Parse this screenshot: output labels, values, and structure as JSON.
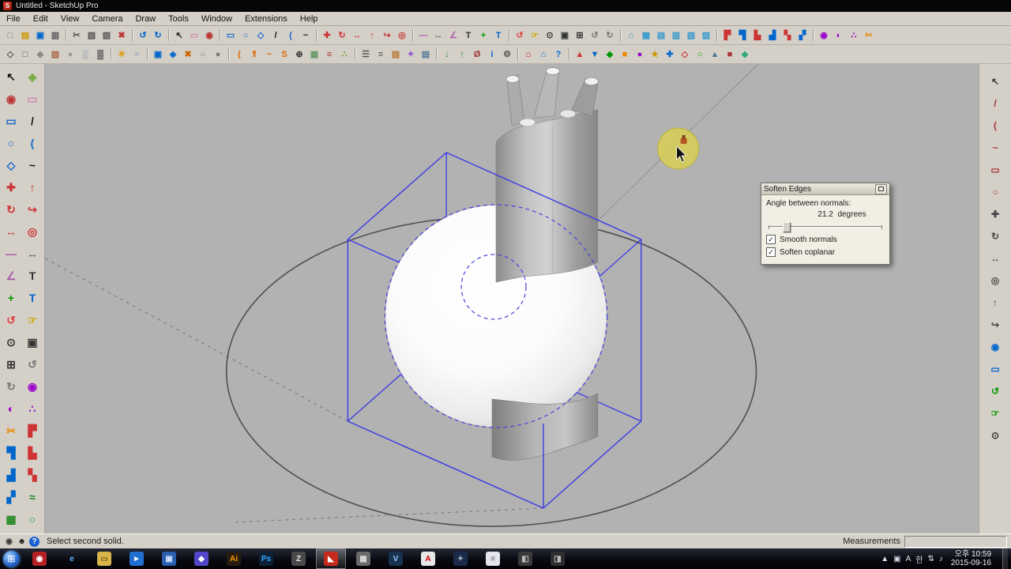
{
  "window": {
    "title": "Untitled - SketchUp Pro",
    "app_icon": "S"
  },
  "menu": {
    "items": [
      "File",
      "Edit",
      "View",
      "Camera",
      "Draw",
      "Tools",
      "Window",
      "Extensions",
      "Help"
    ]
  },
  "toolbar_row1": [
    [
      "new",
      "□",
      "#777"
    ],
    [
      "open",
      "▤",
      "#c90"
    ],
    [
      "save",
      "▣",
      "#06c"
    ],
    [
      "print",
      "▥",
      "#555"
    ],
    [
      "sep"
    ],
    [
      "cut",
      "✂",
      "#555"
    ],
    [
      "copy",
      "▧",
      "#555"
    ],
    [
      "paste",
      "▨",
      "#555"
    ],
    [
      "erase-selected",
      "✖",
      "#b33"
    ],
    [
      "sep"
    ],
    [
      "undo",
      "↺",
      "#06c"
    ],
    [
      "redo",
      "↻",
      "#06c"
    ],
    [
      "sep"
    ],
    [
      "select",
      "↖",
      "#111"
    ],
    [
      "eraser",
      "▭",
      "#c8a"
    ],
    [
      "paint-bucket",
      "◉",
      "#b33"
    ],
    [
      "sep"
    ],
    [
      "rectangle",
      "▭",
      "#16c"
    ],
    [
      "circle",
      "○",
      "#16c"
    ],
    [
      "polygon",
      "◇",
      "#16c"
    ],
    [
      "line",
      "/",
      "#111"
    ],
    [
      "arc",
      "(",
      "#16c"
    ],
    [
      "freehand",
      "~",
      "#111"
    ],
    [
      "sep"
    ],
    [
      "move",
      "✚",
      "#c33"
    ],
    [
      "rotate",
      "↻",
      "#c33"
    ],
    [
      "scale",
      "↔",
      "#c33"
    ],
    [
      "push-pull",
      "↑",
      "#c33"
    ],
    [
      "follow-me",
      "↪",
      "#c33"
    ],
    [
      "offset",
      "◎",
      "#c33"
    ],
    [
      "sep"
    ],
    [
      "tape-measure",
      "―",
      "#a5a"
    ],
    [
      "dimension",
      "↔",
      "#555"
    ],
    [
      "protractor",
      "∠",
      "#a5a"
    ],
    [
      "text",
      "T",
      "#333"
    ],
    [
      "axes",
      "+",
      "#090"
    ],
    [
      "3d-text",
      "T",
      "#06c"
    ],
    [
      "sep"
    ],
    [
      "orbit",
      "↺",
      "#d44"
    ],
    [
      "pan",
      "☞",
      "#ca0"
    ],
    [
      "zoom",
      "⊙",
      "#333"
    ],
    [
      "zoom-window",
      "▣",
      "#333"
    ],
    [
      "zoom-extents",
      "⊞",
      "#333"
    ],
    [
      "zoom-previous",
      "↺",
      "#777"
    ],
    [
      "zoom-next",
      "↻",
      "#777"
    ],
    [
      "sep"
    ],
    [
      "views-iso",
      "⌂",
      "#39c"
    ],
    [
      "views-top",
      "▦",
      "#39c"
    ],
    [
      "views-front",
      "▤",
      "#39c"
    ],
    [
      "views-right",
      "▥",
      "#39c"
    ],
    [
      "views-back",
      "▧",
      "#39c"
    ],
    [
      "views-left",
      "▨",
      "#39c"
    ],
    [
      "sep"
    ],
    [
      "solid-outer-shell",
      "▛",
      "#c33"
    ],
    [
      "solid-intersect",
      "▜",
      "#06c"
    ],
    [
      "solid-union",
      "▙",
      "#c33"
    ],
    [
      "solid-subtract",
      "▟",
      "#06c"
    ],
    [
      "solid-trim",
      "▚",
      "#c33"
    ],
    [
      "solid-split",
      "▞",
      "#06c"
    ],
    [
      "sep"
    ],
    [
      "position-camera",
      "◉",
      "#90c"
    ],
    [
      "look-around",
      "◐",
      "#90c"
    ],
    [
      "walk",
      "∴",
      "#90c"
    ],
    [
      "section-plane",
      "✂",
      "#e80"
    ]
  ],
  "toolbar_row2": [
    [
      "wireframe",
      "◇",
      "#555"
    ],
    [
      "hidden-line",
      "□",
      "#555"
    ],
    [
      "shaded",
      "◆",
      "#888"
    ],
    [
      "shaded-textures",
      "▨",
      "#a64"
    ],
    [
      "monochrome",
      "●",
      "#999"
    ],
    [
      "x-ray",
      "▒",
      "#89a"
    ],
    [
      "back-edges",
      "▓",
      "#666"
    ],
    [
      "sep"
    ],
    [
      "shadows",
      "☀",
      "#d90"
    ],
    [
      "fog",
      "≈",
      "#9ab"
    ],
    [
      "sep"
    ],
    [
      "make-group",
      "▣",
      "#06c"
    ],
    [
      "make-component",
      "◈",
      "#06c"
    ],
    [
      "explode",
      "✖",
      "#c60"
    ],
    [
      "hide",
      "○",
      "#777"
    ],
    [
      "unhide",
      "●",
      "#777"
    ],
    [
      "sep"
    ],
    [
      "round-corner",
      "(",
      "#d60"
    ],
    [
      "joint-push-pull",
      "⇑",
      "#d60"
    ],
    [
      "curviloft",
      "~",
      "#d60"
    ],
    [
      "bezier-spline",
      "S",
      "#d60"
    ],
    [
      "weld",
      "⊕",
      "#333"
    ],
    [
      "soap-skin",
      "▦",
      "#696"
    ],
    [
      "slicer",
      "≡",
      "#a33"
    ],
    [
      "component-spray",
      "∴",
      "#693"
    ],
    [
      "sep"
    ],
    [
      "layers-panel",
      "☰",
      "#555"
    ],
    [
      "outliner",
      "≡",
      "#555"
    ],
    [
      "materials",
      "▧",
      "#b73"
    ],
    [
      "styles-panel",
      "✦",
      "#95c"
    ],
    [
      "scenes",
      "▤",
      "#579"
    ],
    [
      "sep"
    ],
    [
      "import",
      "↓",
      "#283"
    ],
    [
      "export",
      "↑",
      "#283"
    ],
    [
      "purge",
      "Ø",
      "#933"
    ],
    [
      "model-info",
      "i",
      "#06c"
    ],
    [
      "preferences",
      "⚙",
      "#555"
    ],
    [
      "sep"
    ],
    [
      "extension-warehouse",
      "⌂",
      "#b00"
    ],
    [
      "3d-warehouse",
      "⌂",
      "#06c"
    ],
    [
      "instructor",
      "?",
      "#06c"
    ],
    [
      "sep"
    ],
    [
      "plugin-a",
      "▲",
      "#c33"
    ],
    [
      "plugin-b",
      "▼",
      "#06c"
    ],
    [
      "plugin-c",
      "◆",
      "#090"
    ],
    [
      "plugin-d",
      "■",
      "#e80"
    ],
    [
      "plugin-e",
      "●",
      "#90c"
    ],
    [
      "plugin-f",
      "★",
      "#c90"
    ],
    [
      "plugin-g",
      "✚",
      "#06c"
    ],
    [
      "plugin-h",
      "◇",
      "#c33"
    ],
    [
      "plugin-i",
      "○",
      "#090"
    ],
    [
      "plugin-j",
      "▲",
      "#579"
    ],
    [
      "plugin-k",
      "■",
      "#a33"
    ],
    [
      "plugin-l",
      "◆",
      "#3a7"
    ]
  ],
  "left_palette": [
    [
      "select",
      "↖",
      "#111"
    ],
    [
      "make-component",
      "◈",
      "#7a4"
    ],
    [
      "paint-bucket",
      "◉",
      "#b33"
    ],
    [
      "eraser",
      "▭",
      "#c8a"
    ],
    [
      "rectangle",
      "▭",
      "#16c"
    ],
    [
      "line",
      "/",
      "#111"
    ],
    [
      "circle",
      "○",
      "#16c"
    ],
    [
      "arc",
      "(",
      "#16c"
    ],
    [
      "polygon",
      "◇",
      "#16c"
    ],
    [
      "freehand",
      "~",
      "#111"
    ],
    [
      "move",
      "✚",
      "#c33"
    ],
    [
      "push-pull",
      "↑",
      "#c33"
    ],
    [
      "rotate",
      "↻",
      "#c33"
    ],
    [
      "follow-me",
      "↪",
      "#c33"
    ],
    [
      "scale",
      "↔",
      "#c33"
    ],
    [
      "offset",
      "◎",
      "#c33"
    ],
    [
      "tape-measure",
      "―",
      "#a5a"
    ],
    [
      "dimension",
      "↔",
      "#555"
    ],
    [
      "protractor",
      "∠",
      "#a5a"
    ],
    [
      "text",
      "T",
      "#333"
    ],
    [
      "axes",
      "+",
      "#090"
    ],
    [
      "3d-text",
      "T",
      "#06c"
    ],
    [
      "orbit",
      "↺",
      "#d44"
    ],
    [
      "pan",
      "☞",
      "#ca0"
    ],
    [
      "zoom",
      "⊙",
      "#333"
    ],
    [
      "zoom-window",
      "▣",
      "#333"
    ],
    [
      "zoom-extents",
      "⊞",
      "#333"
    ],
    [
      "zoom-previous",
      "↺",
      "#777"
    ],
    [
      "zoom-next",
      "↻",
      "#777"
    ],
    [
      "position-camera",
      "◉",
      "#90c"
    ],
    [
      "look-around",
      "◐",
      "#90c"
    ],
    [
      "walk",
      "∴",
      "#90c"
    ],
    [
      "section-plane",
      "✂",
      "#e80"
    ],
    [
      "solid-outer-shell",
      "▛",
      "#c33"
    ],
    [
      "solid-intersect",
      "▜",
      "#06c"
    ],
    [
      "solid-union",
      "▙",
      "#c33"
    ],
    [
      "solid-subtract",
      "▟",
      "#06c"
    ],
    [
      "solid-trim",
      "▚",
      "#c33"
    ],
    [
      "solid-split",
      "▞",
      "#06c"
    ],
    [
      "sandbox-from-contours",
      "≈",
      "#282"
    ],
    [
      "sandbox-from-scratch",
      "▦",
      "#282"
    ],
    [
      "smoove",
      "○",
      "#282"
    ],
    [
      "sandbox-stamp",
      "▣",
      "#282"
    ],
    [
      "sandbox-drape",
      "▼",
      "#282"
    ]
  ],
  "right_palette": [
    [
      "rp-select",
      "↖",
      "#333"
    ],
    [
      "rp-line",
      "/",
      "#a33"
    ],
    [
      "rp-arc",
      "(",
      "#a33"
    ],
    [
      "rp-freehand",
      "~",
      "#a33"
    ],
    [
      "rp-rect",
      "▭",
      "#a33"
    ],
    [
      "rp-circle",
      "○",
      "#a33"
    ],
    [
      "rp-move",
      "✚",
      "#444"
    ],
    [
      "rp-rotate",
      "↻",
      "#444"
    ],
    [
      "rp-scale",
      "↔",
      "#444"
    ],
    [
      "rp-offset",
      "◎",
      "#444"
    ],
    [
      "rp-pushpull",
      "↑",
      "#444"
    ],
    [
      "rp-followme",
      "↪",
      "#444"
    ],
    [
      "rp-paint",
      "◉",
      "#06c"
    ],
    [
      "rp-eraser",
      "▭",
      "#06c"
    ],
    [
      "rp-orbit",
      "↺",
      "#090"
    ],
    [
      "rp-pan",
      "☞",
      "#090"
    ],
    [
      "rp-zoom",
      "⊙",
      "#333"
    ]
  ],
  "dialog": {
    "title": "Soften Edges",
    "angle_label": "Angle between normals:",
    "angle_value": "21.2",
    "angle_unit": "degrees",
    "smooth_label": "Smooth normals",
    "coplanar_label": "Soften coplanar",
    "smooth_checked": "✓",
    "coplanar_checked": "✓"
  },
  "status": {
    "message": "Select second solid.",
    "measurements_label": "Measurements",
    "icons": [
      [
        "status-geolocation",
        "◉",
        "#3a3a3a",
        ""
      ],
      [
        "status-credit",
        "☻",
        "#222",
        ""
      ],
      [
        "status-help",
        "?",
        "#fff",
        "#1a5fd0"
      ]
    ]
  },
  "taskbar": {
    "start_glyph": "⊞",
    "apps": [
      [
        "red-browser",
        "◉",
        "#b52025",
        "#fff",
        0
      ],
      [
        "internet-explorer",
        "e",
        "transparent",
        "#5ab4ff",
        0
      ],
      [
        "file-explorer",
        "▭",
        "#d9b44a",
        "#7a5c10",
        0
      ],
      [
        "media-player",
        "►",
        "#1f6fd0",
        "#fff",
        0
      ],
      [
        "settings-blue",
        "▣",
        "#2b5fae",
        "#cfe3ff",
        0
      ],
      [
        "kmplayer",
        "◆",
        "#5247c9",
        "#fff",
        0
      ],
      [
        "illustrator",
        "Ai",
        "#271c10",
        "#ff9a00",
        0
      ],
      [
        "photoshop",
        "Ps",
        "#0b2033",
        "#31a8ff",
        0
      ],
      [
        "zbrush",
        "Z",
        "#4a4a4a",
        "#e8e8e8",
        0
      ],
      [
        "sketchup",
        "◣",
        "#c42b1c",
        "#fff",
        1
      ],
      [
        "app-gray",
        "▦",
        "#6a6a6a",
        "#ddd",
        0
      ],
      [
        "vray",
        "V",
        "#16324f",
        "#9cc7ff",
        0
      ],
      [
        "autocad",
        "A",
        "#e8e8e8",
        "#c00",
        0
      ],
      [
        "navy-app",
        "✦",
        "#1b2a4a",
        "#9ab",
        0
      ],
      [
        "notepad",
        "≡",
        "#e6e6ee",
        "#667",
        0
      ],
      [
        "dark-app-1",
        "◧",
        "#3a3a3a",
        "#bbb",
        0
      ],
      [
        "dark-app-2",
        "◨",
        "#2e2e2e",
        "#bbb",
        0
      ]
    ],
    "tray": [
      [
        "tray-expand",
        "▲"
      ],
      [
        "tray-display",
        "▣"
      ],
      [
        "ime-a",
        "A"
      ],
      [
        "ime-hangul",
        "한"
      ],
      [
        "tray-network",
        "⇅"
      ],
      [
        "tray-volume",
        "♪"
      ]
    ],
    "time": "오후 10:59",
    "date": "2015-09-16"
  },
  "colors": {
    "selection_blue": "#3a3ae6",
    "canvas_gray": "#b2b2b2",
    "highlight_yellow": "#d8cf52",
    "chrome_gray": "#d4d0c8"
  }
}
